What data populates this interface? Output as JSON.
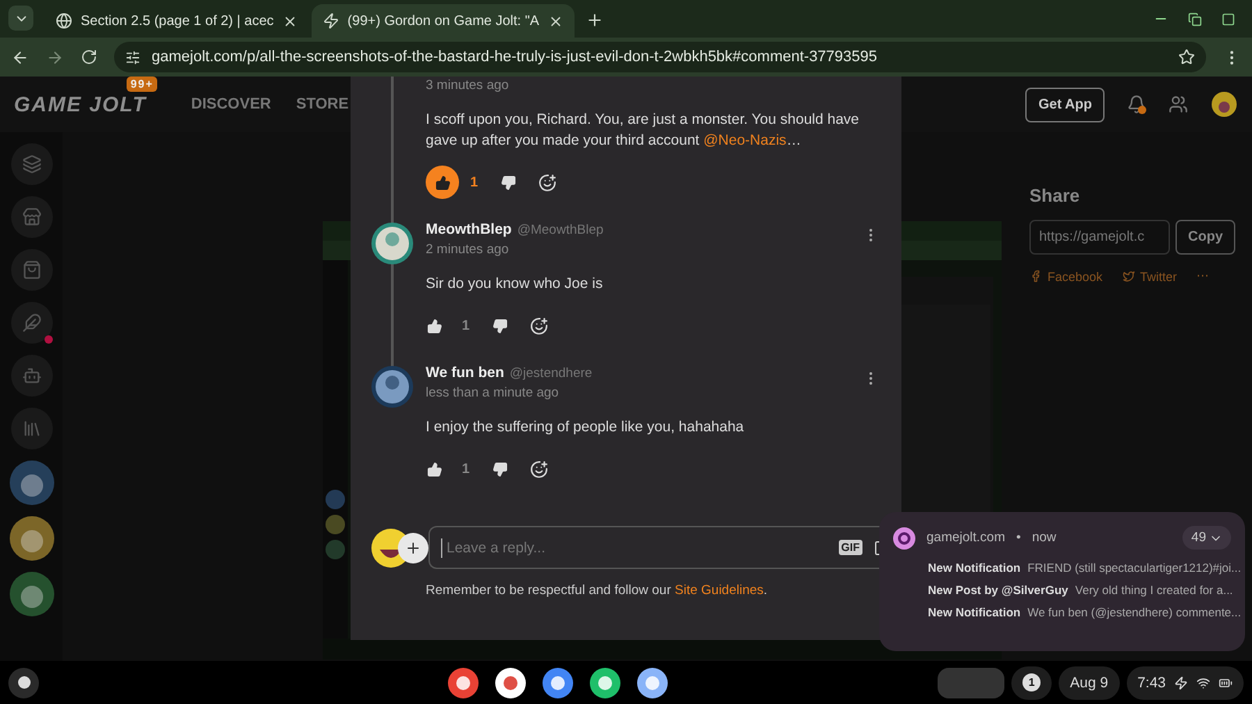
{
  "browser": {
    "tabs": [
      {
        "title": "Section 2.5 (page 1 of 2) | acec",
        "selected": false
      },
      {
        "title": "(99+) Gordon on Game Jolt: \"A",
        "selected": true
      }
    ],
    "url": "gamejolt.com/p/all-the-screenshots-of-the-bastard-he-truly-is-just-evil-don-t-2wbkh5bk#comment-37793595"
  },
  "site": {
    "logo": "GAME JOLT",
    "badge": "99+",
    "nav": [
      "DISCOVER",
      "STORE"
    ],
    "get_app": "Get App",
    "bell_unread": true
  },
  "sidebar": {
    "items": [
      {
        "kind": "icon",
        "unread": false
      },
      {
        "kind": "icon",
        "unread": false
      },
      {
        "kind": "icon",
        "unread": false
      },
      {
        "kind": "icon",
        "unread": true
      },
      {
        "kind": "icon",
        "unread": false
      },
      {
        "kind": "icon",
        "unread": false
      },
      {
        "kind": "avatar",
        "unread": false
      },
      {
        "kind": "avatar",
        "unread": false
      },
      {
        "kind": "avatar",
        "unread": false
      }
    ]
  },
  "share": {
    "title": "Share",
    "url": "https://gamejolt.c",
    "copy": "Copy",
    "links": [
      "Facebook",
      "Twitter"
    ],
    "more": "⋯"
  },
  "comments": [
    {
      "time": "3 minutes ago",
      "text": "I scoff upon you, Richard. You, are just a monster. You should have gave up after you made your third account ",
      "mention": "@Neo-Nazis",
      "after": "…",
      "likes": "1",
      "liked": true
    },
    {
      "author": "MeowthBlep",
      "handle": "@MeowthBlep",
      "time": "2 minutes ago",
      "text": "Sir do you know who Joe is",
      "likes": "1",
      "liked": false
    },
    {
      "author": "We fun ben",
      "handle": "@jestendhere",
      "time": "less than a minute ago",
      "text": "I enjoy the suffering of people like you, hahahaha",
      "likes": "1",
      "liked": false
    }
  ],
  "reply": {
    "placeholder": "Leave a reply...",
    "gif": "GIF",
    "note": "Remember to be respectful and follow our ",
    "link": "Site Guidelines",
    "end": "."
  },
  "notification": {
    "source": "gamejolt.com",
    "separator": "•",
    "time": "now",
    "count": "49",
    "items": [
      {
        "title": "New Notification",
        "body": "FRIEND (still spectaculartiger1212)#joi..."
      },
      {
        "title": "New Post by @SilverGuy",
        "body": "Very old thing I created for a..."
      },
      {
        "title": "New Notification",
        "body": "We fun ben (@jestendhere) commente..."
      }
    ]
  },
  "shelf": {
    "notifications": "1",
    "date": "Aug 9",
    "time": "7:43"
  }
}
